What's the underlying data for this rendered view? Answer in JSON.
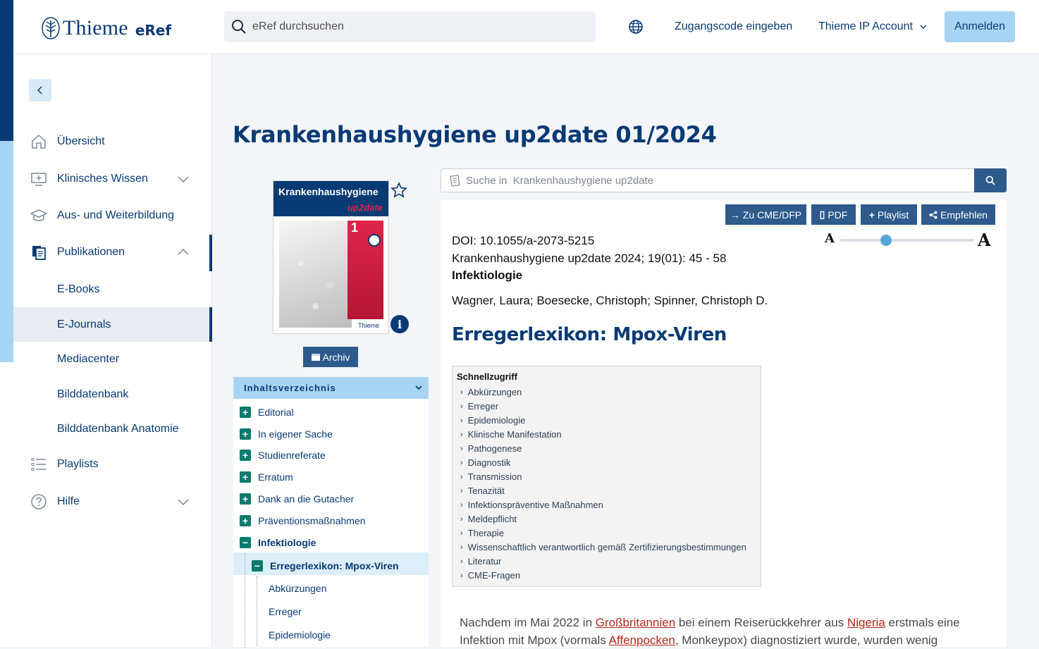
{
  "header": {
    "logo_text": "Thieme",
    "logo_product": "eRef",
    "search_placeholder": "eRef durchsuchen",
    "zugangscode": "Zugangscode eingeben",
    "ip_account": "Thieme IP Account",
    "login": "Anmelden"
  },
  "sidebar": {
    "items": [
      {
        "label": "Übersicht",
        "icon": "home-icon"
      },
      {
        "label": "Klinisches Wissen",
        "icon": "monitor-medical-icon"
      },
      {
        "label": "Aus- und Weiterbildung",
        "icon": "graduation-cap-icon"
      },
      {
        "label": "Publikationen",
        "icon": "publications-icon"
      },
      {
        "label": "Playlists",
        "icon": "list-icon"
      },
      {
        "label": "Hilfe",
        "icon": "help-icon"
      }
    ],
    "sub_items": [
      "E-Books",
      "E-Journals",
      "Mediacenter",
      "Bilddatenbank",
      "Bilddatenbank Anatomie"
    ]
  },
  "page": {
    "title": "Krankenhaushygiene up2date 01/2024"
  },
  "cover": {
    "title": "Krankenhaushygiene",
    "subtitle": "up2date",
    "issue": "1",
    "publisher": "Thieme"
  },
  "archiv_label": "Archiv",
  "toc": {
    "header": "Inhaltsverzeichnis",
    "items": [
      "Editorial",
      "In eigener Sache",
      "Studienreferate",
      "Erratum",
      "Dank an die Gutacher",
      "Präventionsmaßnahmen",
      "Infektiologie"
    ],
    "selected_article": "Erregerlexikon: Mpox-Viren",
    "sub_sections": [
      "Abkürzungen",
      "Erreger",
      "Epidemiologie"
    ]
  },
  "journal_search_placeholder": "Suche in  Krankenhaushygiene up2date",
  "article": {
    "buttons": {
      "cme": "Zu CME/DFP",
      "pdf": "PDF",
      "playlist": "Playlist",
      "recommend": "Empfehlen"
    },
    "doi": "DOI: 10.1055/a-2073-5215",
    "citation": "Krankenhaushygiene up2date 2024; 19(01): 45 - 58",
    "section": "Infektiologie",
    "authors": "Wagner, Laura; Boesecke, Christoph; Spinner, Christoph D.",
    "title": "Erregerlexikon: Mpox-Viren",
    "font_small": "A",
    "font_large": "A",
    "font_size_level": 0.35
  },
  "quick_access": {
    "title": "Schnellzugriff",
    "links": [
      "Abkürzungen",
      "Erreger",
      "Epidemiologie",
      "Klinische Manifestation",
      "Pathogenese",
      "Diagnostik",
      "Transmission",
      "Tenazität",
      "Infektionspräventive Maßnahmen",
      "Meldepflicht",
      "Therapie",
      "Wissenschaftlich verantwortlich gemäß Zertifizierungsbestimmungen",
      "Literatur",
      "CME-Fragen"
    ]
  },
  "body": {
    "p1_a": "Nachdem im Mai 2022 in ",
    "p1_link1": "Großbritannien",
    "p1_b": " bei einem Reiserückkehrer aus ",
    "p1_link2": "Nigeria",
    "p1_c": " erstmals eine Infektion mit Mpox (vormals ",
    "p1_link3": "Affenpocken",
    "p1_d": ", Monkeypox) diagnostiziert wurde, wurden wenig"
  }
}
